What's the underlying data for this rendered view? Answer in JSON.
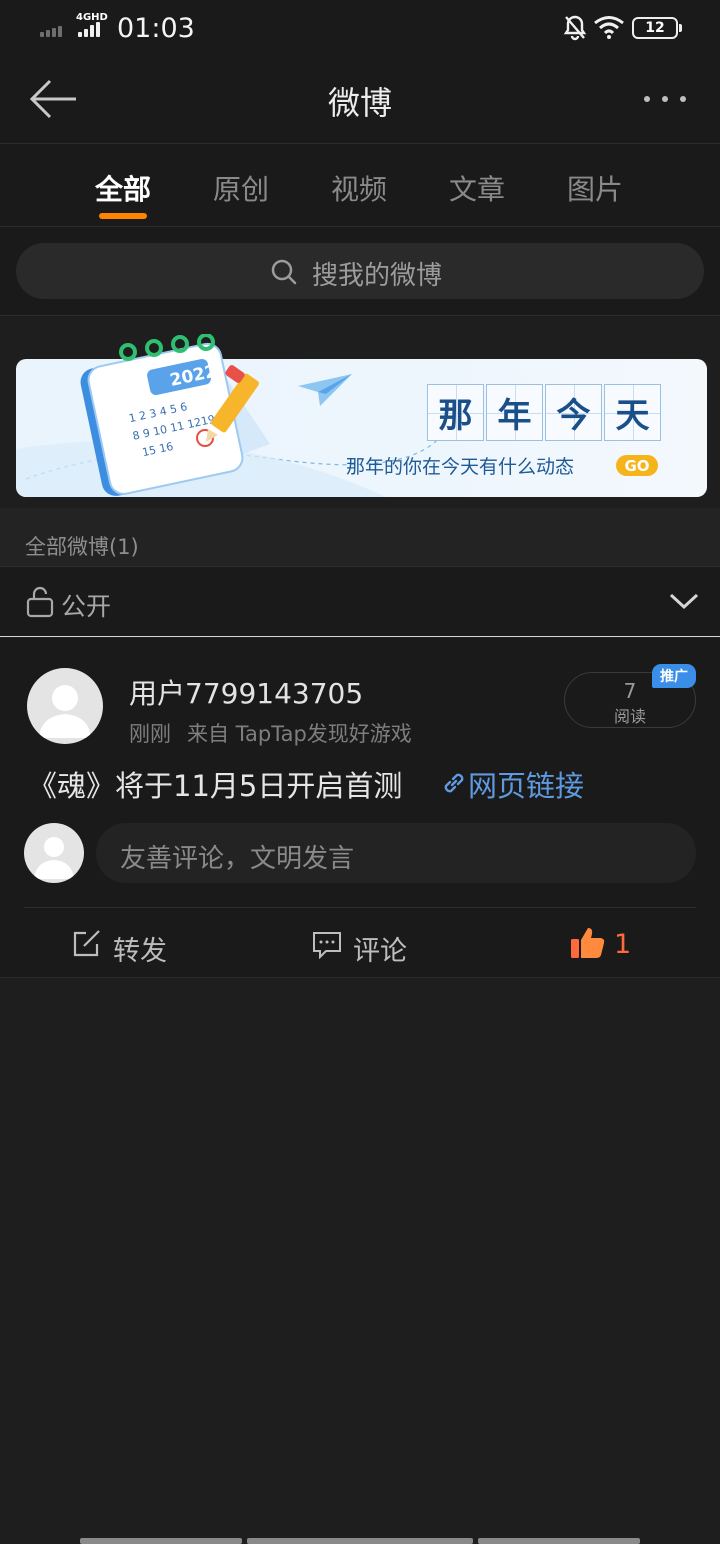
{
  "status_bar": {
    "network_type": "4GHD",
    "time": "01:03",
    "battery": "12",
    "icons": [
      "signal-icon",
      "mute-bell-icon",
      "wifi-icon",
      "battery-icon"
    ]
  },
  "nav": {
    "title": "微博",
    "back_icon": "back-arrow-icon",
    "more_icon": "more-dots-icon"
  },
  "tabs": [
    {
      "label": "全部",
      "active": true
    },
    {
      "label": "原创",
      "active": false
    },
    {
      "label": "视频",
      "active": false
    },
    {
      "label": "文章",
      "active": false
    },
    {
      "label": "图片",
      "active": false
    }
  ],
  "search": {
    "placeholder": "搜我的微博"
  },
  "banner": {
    "calendar_year": "2022",
    "title_chars": [
      "那",
      "年",
      "今",
      "天"
    ],
    "subtitle": "那年的你在今天有什么动态",
    "go_label": "GO"
  },
  "section": {
    "label": "全部微博(1)"
  },
  "visibility": {
    "label": "公开"
  },
  "post": {
    "username": "用户7799143705",
    "time": "刚刚",
    "source": "来自 TapTap发现好游戏",
    "read_count": "7",
    "read_label": "阅读",
    "promo_badge": "推广",
    "text": "《魂》将于11月5日开启首测",
    "link_label": "网页链接",
    "comment_placeholder": "友善评论，文明发言",
    "actions": {
      "repost_label": "转发",
      "comment_label": "评论",
      "like_count": "1"
    }
  },
  "colors": {
    "accent": "#ff8200",
    "link": "#5f9ae0",
    "like": "#ff6a3d",
    "promo": "#3b8ee8"
  }
}
